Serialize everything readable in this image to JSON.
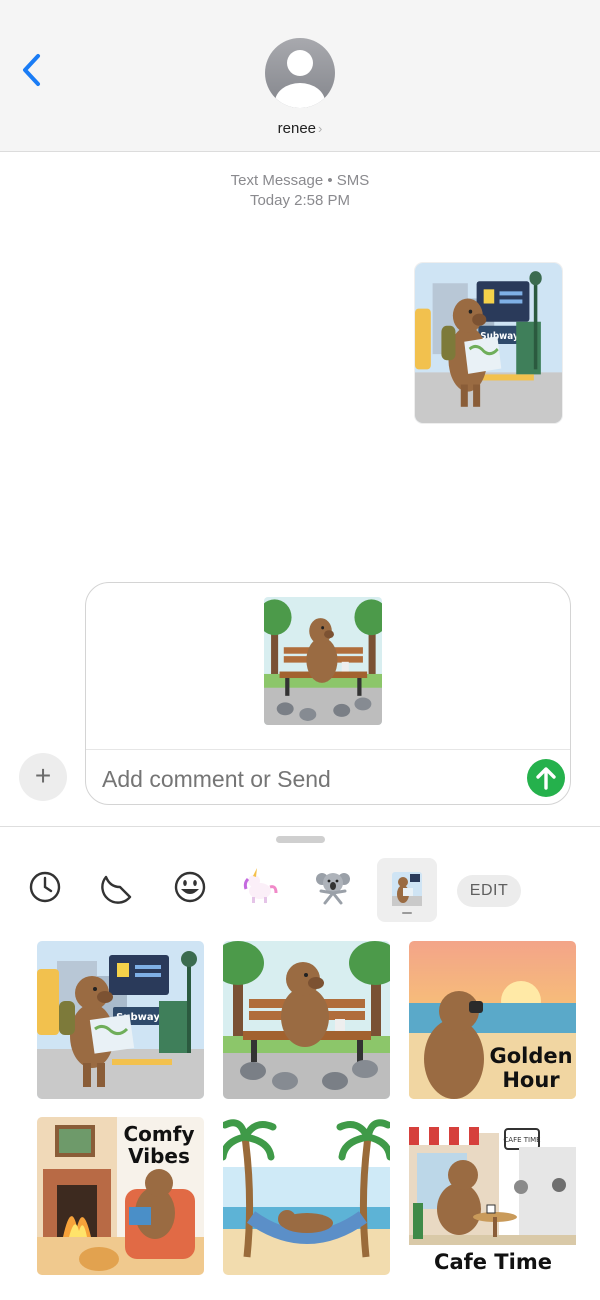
{
  "header": {
    "contact_name": "renee",
    "back_icon": "chevron-left-icon",
    "avatar_icon": "person-avatar-icon"
  },
  "conversation": {
    "service_label": "Text Message • SMS",
    "day_label": "Today",
    "time_label": "2:58 PM",
    "sent_sticker": {
      "caption": "Subway",
      "icon": "capybara-subway-sticker"
    }
  },
  "compose": {
    "plus_label": "+",
    "placeholder": "Add comment or Send",
    "attachment": {
      "icon": "capybara-park-bench-sticker"
    },
    "send_icon": "arrow-up-icon"
  },
  "tray": {
    "edit_label": "EDIT",
    "icons": [
      "clock-recents-icon",
      "sticker-peel-icon",
      "emoji-face-icon",
      "unicorn-sticker-icon",
      "koala-sticker-icon",
      "capybara-sticker-pack-icon"
    ],
    "stickers": [
      {
        "name": "subway",
        "text": "Subway"
      },
      {
        "name": "park-bench",
        "text": ""
      },
      {
        "name": "golden-hour",
        "text": "Golden Hour",
        "line1": "Golden",
        "line2": "Hour"
      },
      {
        "name": "comfy-vibes",
        "text": "Comfy Vibes",
        "line1": "Comfy",
        "line2": "Vibes"
      },
      {
        "name": "hammock",
        "text": ""
      },
      {
        "name": "cafe-time",
        "text": "Cafe Time",
        "sign": "CAFE TIME"
      }
    ]
  },
  "colors": {
    "accent_blue": "#1a7cf5",
    "send_green": "#25b14c",
    "meta_gray": "#8a8a8e",
    "capybara_brown": "#9a6b42"
  }
}
